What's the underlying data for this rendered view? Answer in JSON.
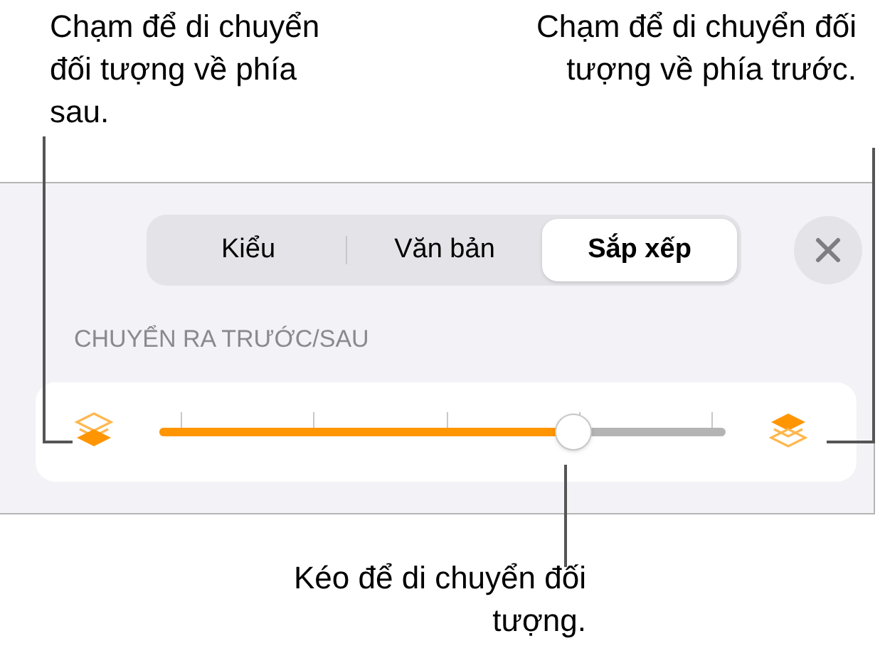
{
  "callouts": [
    {
      "text": "Chạm để di chuyển đối tượng về phía sau."
    },
    {
      "text": "Chạm để di chuyển đối tượng về phía trước."
    },
    {
      "text": "Kéo để di chuyển đối tượng."
    }
  ],
  "tabs": [
    {
      "label": "Kiểu",
      "selected": false
    },
    {
      "label": "Văn bản",
      "selected": false
    },
    {
      "label": "Sắp xếp",
      "selected": true
    }
  ],
  "section_label": "CHUYỂN RA TRƯỚC/SAU",
  "slider": {
    "level": 0.73
  }
}
